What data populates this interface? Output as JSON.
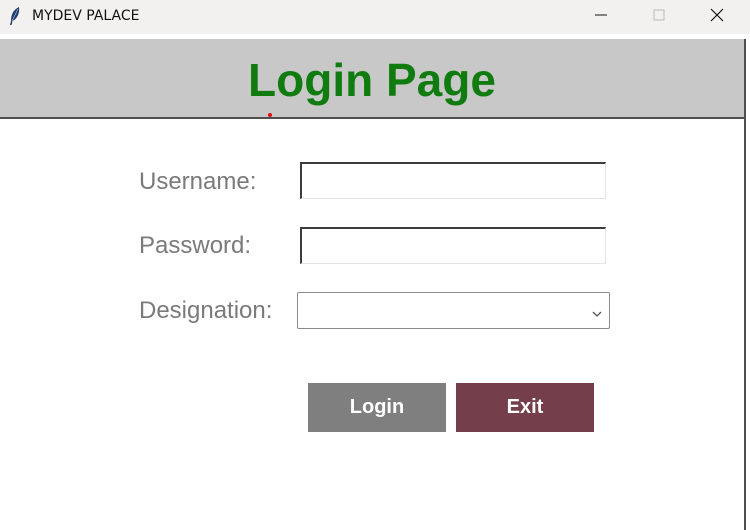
{
  "window": {
    "title": "MYDEV PALACE",
    "icon": "feather-icon",
    "controls": [
      "minimize-icon",
      "maximize-icon",
      "close-icon"
    ]
  },
  "header": {
    "title": "Login Page",
    "background": "#c8c8c8",
    "title_color": "#107c10"
  },
  "form": {
    "username": {
      "label": "Username:",
      "value": ""
    },
    "password": {
      "label": "Password:",
      "value": ""
    },
    "designation": {
      "label": "Designation:",
      "selected": ""
    }
  },
  "buttons": {
    "login": {
      "label": "Login",
      "color": "#7f7f7f"
    },
    "exit": {
      "label": "Exit",
      "color": "#743f4b"
    }
  }
}
